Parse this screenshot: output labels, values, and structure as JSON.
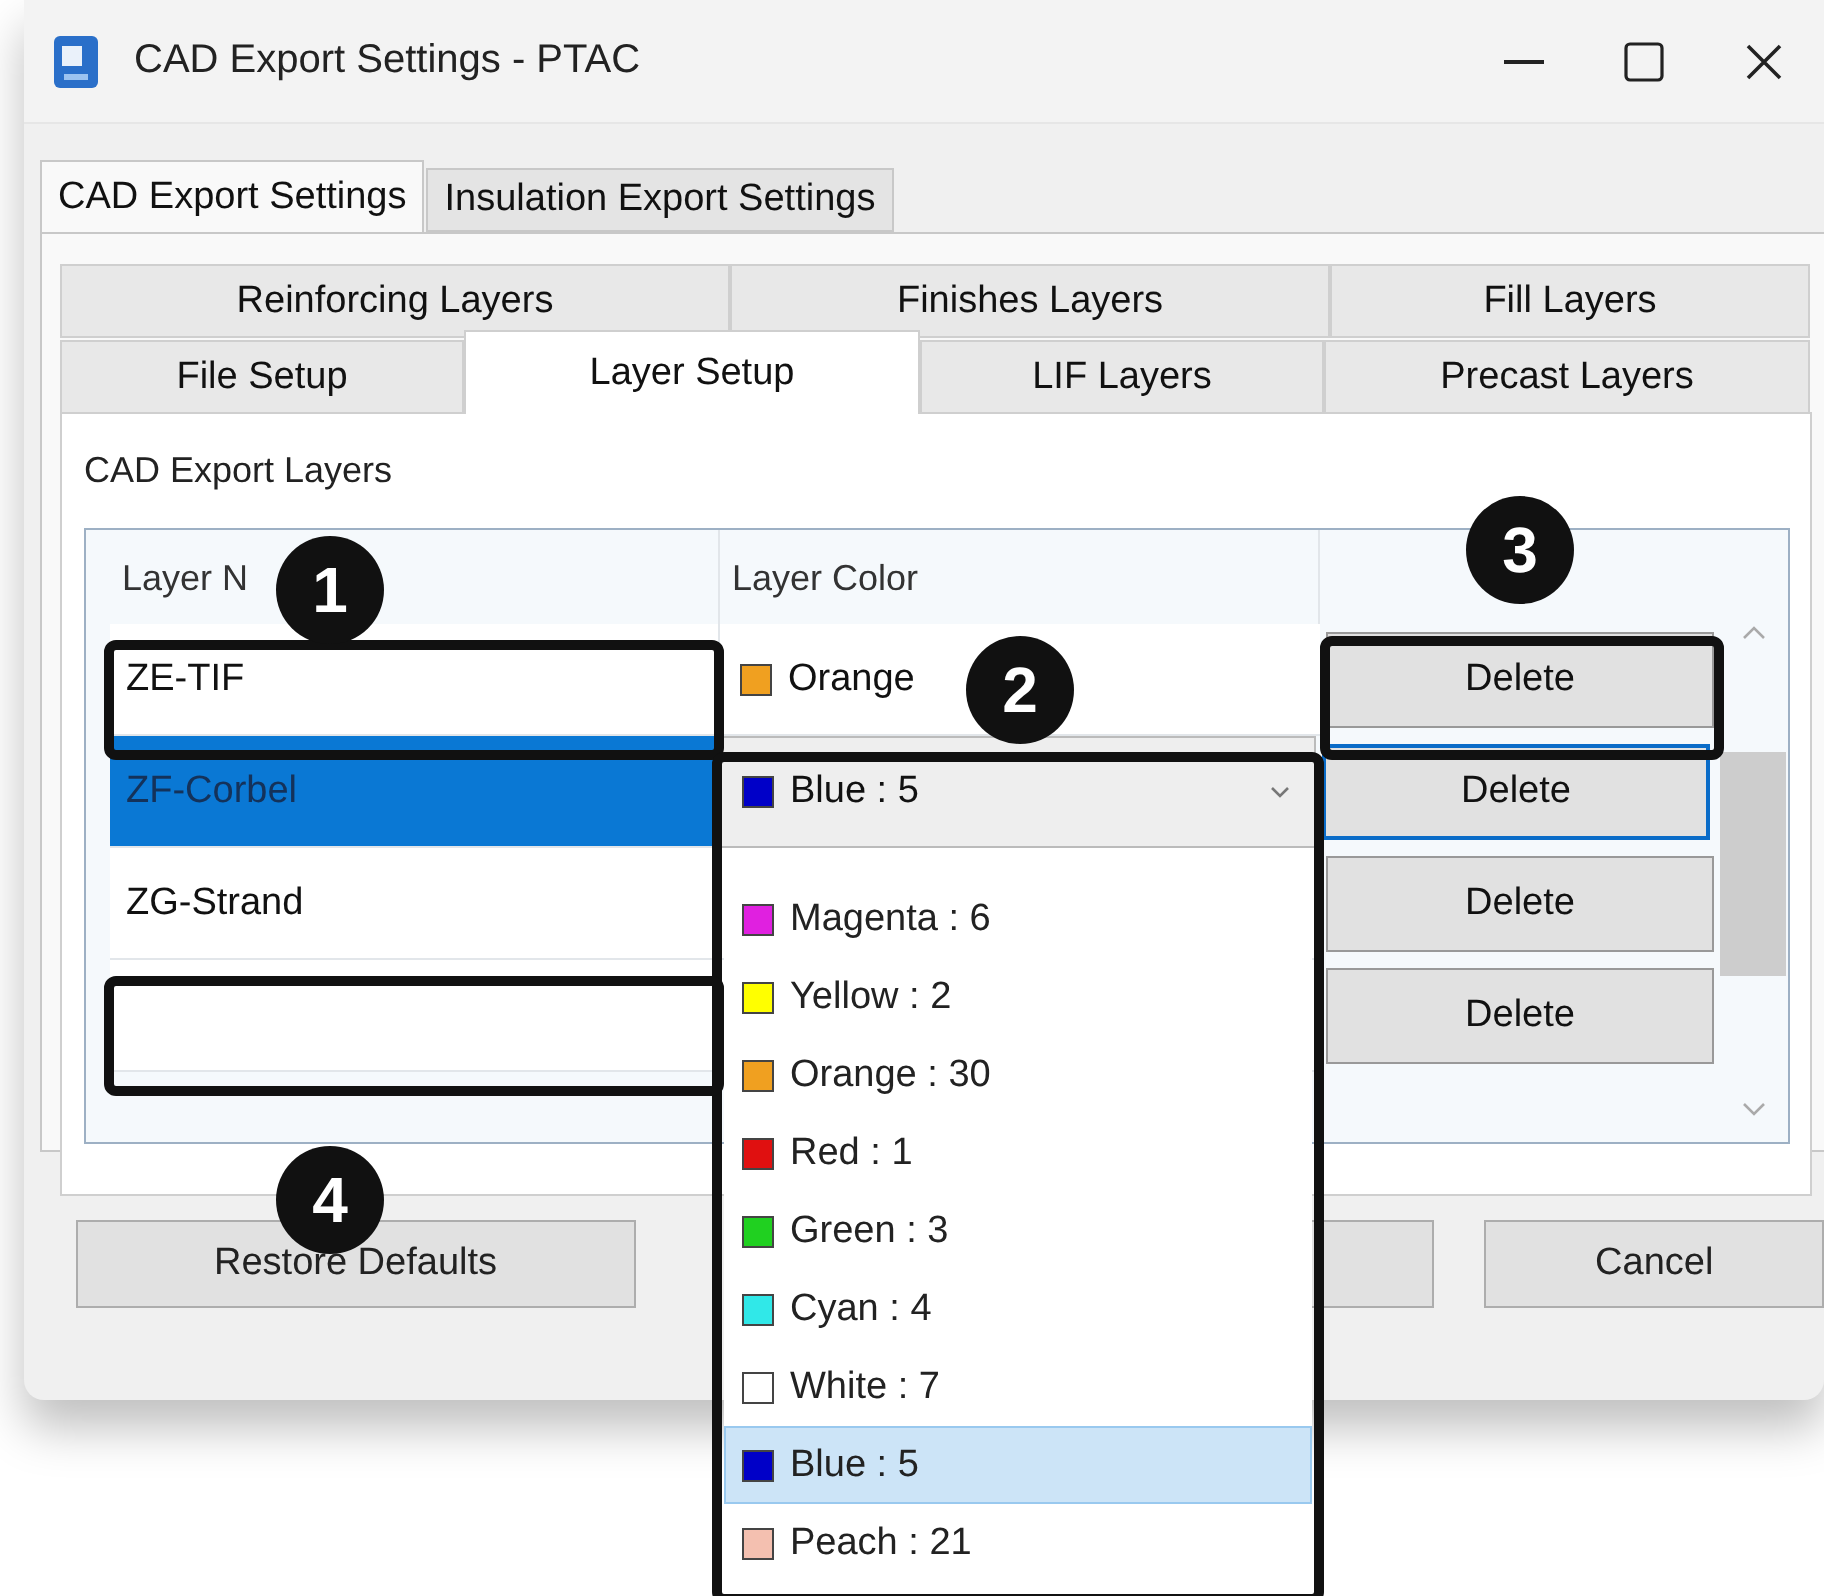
{
  "window": {
    "title": "CAD Export Settings - PTAC"
  },
  "outer_tabs": [
    {
      "label": "CAD Export Settings",
      "selected": true
    },
    {
      "label": "Insulation Export Settings",
      "selected": false
    }
  ],
  "inner_tabs": [
    [
      {
        "label": "Reinforcing Layers",
        "selected": false
      },
      {
        "label": "Finishes Layers",
        "selected": false
      },
      {
        "label": "Fill Layers",
        "selected": false
      }
    ],
    [
      {
        "label": "File Setup",
        "selected": false
      },
      {
        "label": "Layer Setup",
        "selected": true
      },
      {
        "label": "LIF Layers",
        "selected": false
      },
      {
        "label": "Precast Layers",
        "selected": false
      }
    ]
  ],
  "section_label": "CAD Export Layers",
  "table": {
    "columns": [
      "Layer N",
      "Layer Color"
    ],
    "rows": [
      {
        "name": "ZE-TIF",
        "kind": "swatch",
        "color_label": "Orange",
        "color": "#f0a020",
        "selected": false,
        "action": "Delete"
      },
      {
        "name": "ZF-Corbel",
        "kind": "combo",
        "color_label": "Blue : 5",
        "color": "#0000c8",
        "selected": true,
        "action": "Delete"
      },
      {
        "name": "ZG-Strand",
        "kind": "empty",
        "selected": false,
        "action": "Delete"
      },
      {
        "kind": "empty",
        "selected": false,
        "action": "Delete"
      }
    ]
  },
  "color_dropdown": {
    "items": [
      {
        "label": "Magenta : 6",
        "color": "#e020e0",
        "selected": false
      },
      {
        "label": "Yellow : 2",
        "color": "#ffff00",
        "selected": false
      },
      {
        "label": "Orange : 30",
        "color": "#f0a020",
        "selected": false
      },
      {
        "label": "Red : 1",
        "color": "#e01010",
        "selected": false
      },
      {
        "label": "Green : 3",
        "color": "#20d020",
        "selected": false
      },
      {
        "label": "Cyan : 4",
        "color": "#30e8e8",
        "selected": false
      },
      {
        "label": "White : 7",
        "color": "#ffffff",
        "selected": false
      },
      {
        "label": "Blue : 5",
        "color": "#0000c8",
        "selected": true
      },
      {
        "label": "Peach : 21",
        "color": "#f4c0b0",
        "selected": false
      }
    ]
  },
  "buttons": {
    "left": "Restore Defaults",
    "right": "Cancel"
  },
  "annotations": [
    {
      "label": "1"
    },
    {
      "label": "2"
    },
    {
      "label": "3"
    },
    {
      "label": "4"
    }
  ]
}
